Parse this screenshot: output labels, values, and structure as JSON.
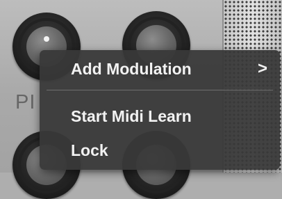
{
  "plugin_panel": {
    "knob_label": "PI"
  },
  "context_menu": {
    "items": [
      {
        "label": "Add Modulation",
        "submenu_icon": "chevron-right-icon",
        "submenu_glyph": ">"
      },
      {
        "label": "Start Midi Learn"
      },
      {
        "label": "Lock"
      }
    ]
  }
}
